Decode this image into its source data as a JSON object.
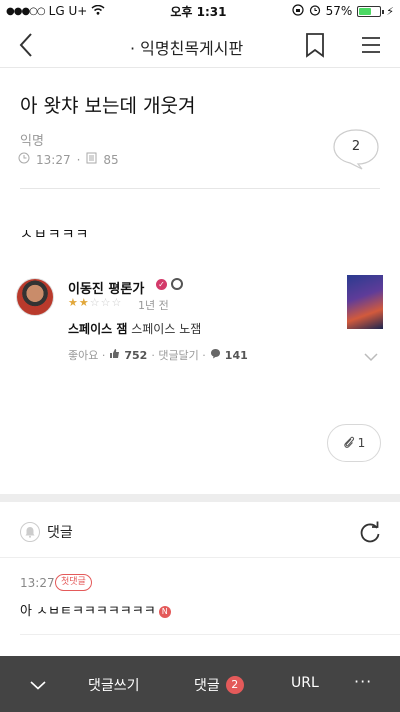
{
  "status": {
    "carrier": "LG U+",
    "time": "오후 1:31",
    "battery": "57%",
    "battery_level": 0.57
  },
  "nav": {
    "title": "· 익명친목게시판"
  },
  "post": {
    "title": "아 왓챠 보는데 개웃겨",
    "author": "익명",
    "time": "13:27",
    "views": "85",
    "comment_count": "2",
    "body": "ㅅㅂㅋㅋㅋ"
  },
  "review_card": {
    "name": "이동진 평론가",
    "rating_stars": 2,
    "rating_max": 5,
    "time": "1년 전",
    "movie_title": "스페이스 잼",
    "review": "스페이스 노잼",
    "like_label": "좋아요 ·",
    "likes": "752",
    "reply_label": "· 댓글달기 ·",
    "replies": "141"
  },
  "attachments": {
    "count": "1"
  },
  "comments": {
    "header": "댓글",
    "items": [
      {
        "time": "13:27",
        "badge": "첫댓글",
        "text": "아 ㅅㅂㅌㅋㅋㅋㅋㅋㅋㅋ",
        "new_badge": "N"
      }
    ]
  },
  "bottom_bar": {
    "write": "댓글쓰기",
    "comments": "댓글",
    "count": "2",
    "url": "URL",
    "more": "···"
  },
  "colors": {
    "accent": "#e45a5a",
    "bar": "#444444",
    "star": "#e1a73a"
  }
}
